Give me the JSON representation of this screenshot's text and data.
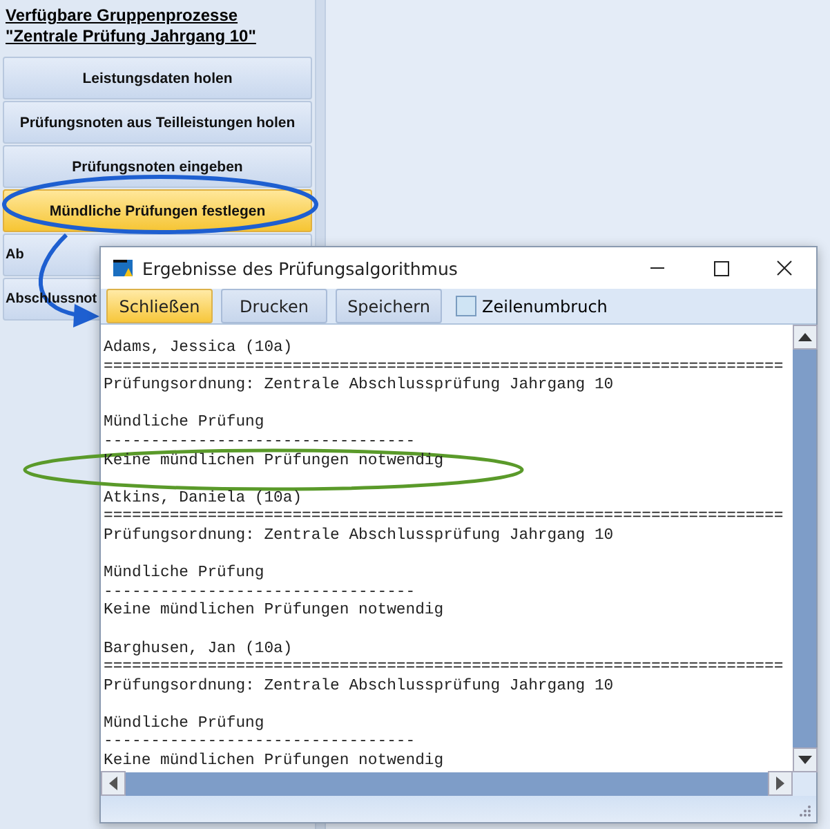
{
  "sidebar": {
    "title": "Verfügbare Gruppenprozesse \"Zentrale Prüfung Jahrgang 10\"",
    "items": [
      {
        "label": "Leistungsdaten holen",
        "selected": false,
        "clipped": false
      },
      {
        "label": "Prüfungsnoten aus Teilleistungen holen",
        "selected": false,
        "clipped": false
      },
      {
        "label": "Prüfungsnoten eingeben",
        "selected": false,
        "clipped": false
      },
      {
        "label": "Mündliche Prüfungen festlegen",
        "selected": true,
        "clipped": false
      },
      {
        "label": "Ab",
        "selected": false,
        "clipped": true
      },
      {
        "label": "Abschlussnot",
        "selected": false,
        "clipped": true
      }
    ]
  },
  "dialog": {
    "title": "Ergebnisse des Prüfungsalgorithmus",
    "buttons": [
      {
        "label": "Schließen",
        "default": true
      },
      {
        "label": "Drucken",
        "default": false
      },
      {
        "label": "Speichern",
        "default": false
      }
    ],
    "checkbox": {
      "label": "Zeilenumbruch",
      "checked": false
    },
    "entries": [
      {
        "student": "Adams, Jessica (10a)",
        "rule": "========================================================================",
        "ordnung": "Prüfungsordnung: Zentrale Abschlussprüfung Jahrgang 10",
        "section": "Mündliche Prüfung",
        "dashes": "---------------------------------",
        "result": "Keine mündlichen Prüfungen notwendig"
      },
      {
        "student": "Atkins, Daniela (10a)",
        "rule": "========================================================================",
        "ordnung": "Prüfungsordnung: Zentrale Abschlussprüfung Jahrgang 10",
        "section": "Mündliche Prüfung",
        "dashes": "---------------------------------",
        "result": "Keine mündlichen Prüfungen notwendig"
      },
      {
        "student": "Barghusen, Jan (10a)",
        "rule": "========================================================================",
        "ordnung": "Prüfungsordnung: Zentrale Abschlussprüfung Jahrgang 10",
        "section": "Mündliche Prüfung",
        "dashes": "---------------------------------",
        "result": "Keine mündlichen Prüfungen notwendig"
      }
    ]
  }
}
